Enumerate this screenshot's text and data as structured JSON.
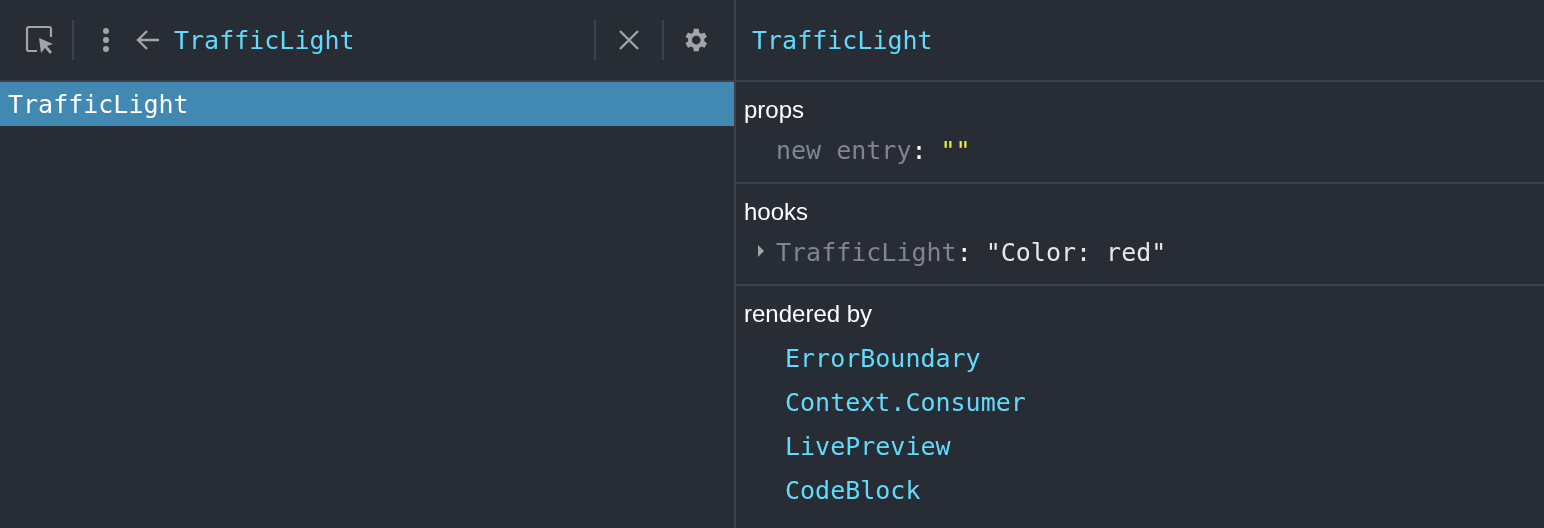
{
  "toolbar": {
    "component_name": "TrafficLight"
  },
  "tree": [
    {
      "label": "TrafficLight",
      "selected": true
    }
  ],
  "inspector": {
    "title": "TrafficLight",
    "props": {
      "title": "props",
      "entries": [
        {
          "key": "new entry",
          "separator": ":",
          "value": "\"\""
        }
      ]
    },
    "hooks": {
      "title": "hooks",
      "entries": [
        {
          "key": "TrafficLight",
          "separator": ":",
          "value": "\"Color: red\"",
          "expanded": false
        }
      ]
    },
    "rendered_by": {
      "title": "rendered by",
      "items": [
        "ErrorBoundary",
        "Context.Consumer",
        "LivePreview",
        "CodeBlock"
      ]
    }
  }
}
